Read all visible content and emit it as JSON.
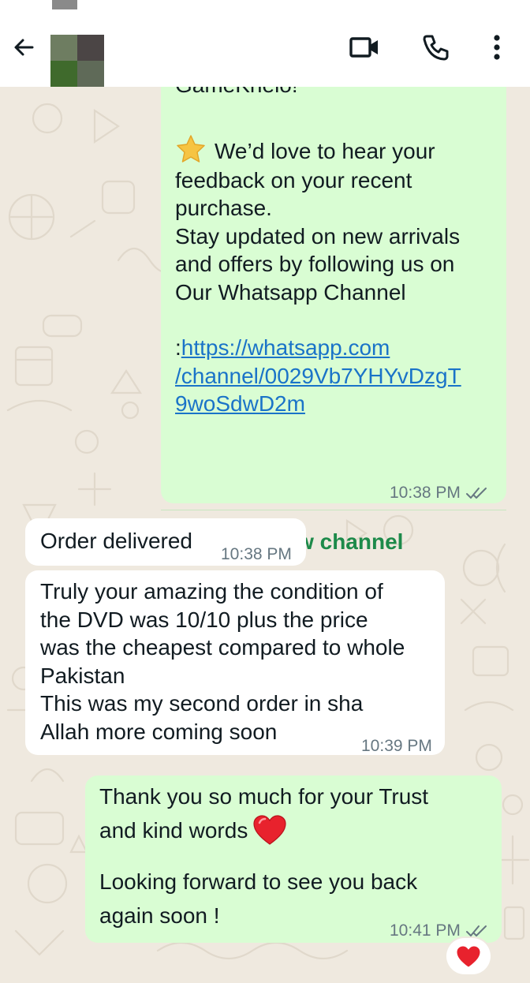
{
  "header": {
    "back_icon": "arrow-left-icon",
    "video_icon": "video-camera-icon",
    "call_icon": "phone-icon",
    "menu_icon": "more-vertical-icon"
  },
  "messages": [
    {
      "direction": "outgoing",
      "lines_top": [
        "GameKhelo!^"
      ],
      "feedback_lines": [
        "We’d love to hear your",
        "feedback on your recent",
        "purchase.",
        "Stay updated on new arrivals",
        "and offers by following us on",
        "Our Whatsapp Channel"
      ],
      "link_prefix": ":",
      "link_lines": [
        "https://whatsapp.com",
        "/channel/0029Vb7YHYvDzgT",
        "9woSdwD2m"
      ],
      "time": "10:38 PM",
      "status": "read",
      "action_label": "View channel"
    },
    {
      "direction": "incoming",
      "text": "Order delivered",
      "time": "10:38 PM"
    },
    {
      "direction": "incoming",
      "lines": [
        "Truly your amazing the condition of",
        "the DVD was 10/10 plus the price",
        "was the cheapest compared to whole",
        "Pakistan",
        "This was my second order in sha",
        "Allah more coming soon"
      ],
      "time": "10:39 PM"
    },
    {
      "direction": "outgoing",
      "lines_a": [
        "Thank you so much for your Trust",
        "and kind words"
      ],
      "lines_b": [
        "Looking forward to see you back",
        "again soon !"
      ],
      "time": "10:41 PM",
      "status": "read",
      "reaction": "heart"
    }
  ],
  "colors": {
    "outgoing_bubble": "#d9fdd3",
    "incoming_bubble": "#ffffff",
    "link": "#1a73c8",
    "accent": "#1d8a4a",
    "wallpaper": "#efe9df"
  }
}
